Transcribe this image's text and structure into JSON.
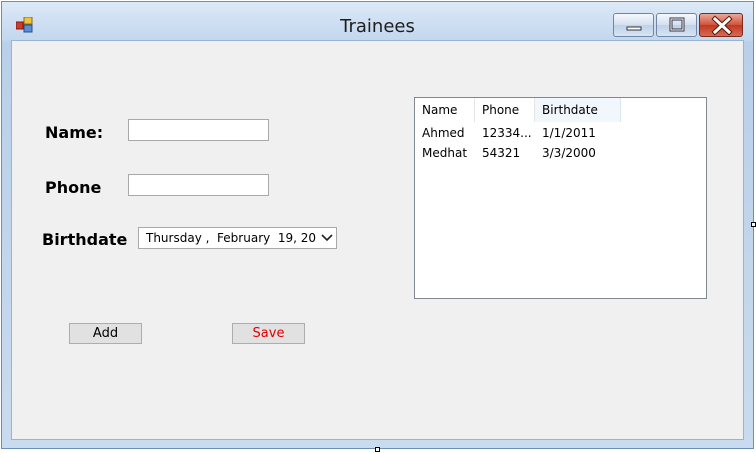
{
  "window": {
    "title": "Trainees",
    "controls": {
      "minimize": "minimize-icon",
      "maximize": "maximize-icon",
      "close": "close-icon"
    }
  },
  "form": {
    "name_label": "Name:",
    "name_value": "",
    "phone_label": "Phone",
    "phone_value": "",
    "birthdate_label": "Birthdate",
    "birthdate_value": "Thursday ,  February  19, 20",
    "add_label": "Add",
    "save_label": "Save"
  },
  "list": {
    "columns": [
      "Name",
      "Phone",
      "Birthdate"
    ],
    "rows": [
      [
        "Ahmed",
        "12334...",
        "1/1/2011"
      ],
      [
        "Medhat",
        "54321",
        "3/3/2000"
      ]
    ]
  },
  "colors": {
    "save_text": "#e00000",
    "client_bg": "#f0f0f0",
    "close_button": "#c0381f"
  }
}
